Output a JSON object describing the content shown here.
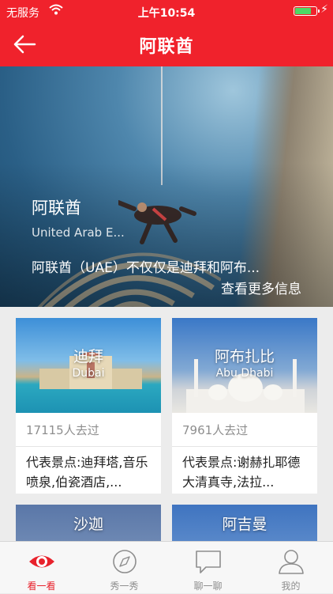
{
  "status_bar": {
    "carrier": "无服务",
    "time": "上午10:54"
  },
  "nav": {
    "title": "阿联酋"
  },
  "hero": {
    "title": "阿联酋",
    "subtitle": "United Arab E...",
    "description": "阿联酋（UAE）不仅仅是迪拜和阿布...",
    "more_link": "查看更多信息"
  },
  "destinations": [
    {
      "name_cn": "迪拜",
      "name_en": "Dubai",
      "visits": "17115人去过",
      "highlights": "代表景点:迪拜塔,音乐喷泉,伯瓷酒店,..."
    },
    {
      "name_cn": "阿布扎比",
      "name_en": "Abu Dhabi",
      "visits": "7961人去过",
      "highlights": "代表景点:谢赫扎耶德大清真寺,法拉..."
    },
    {
      "name_cn": "沙迦",
      "name_en": ""
    },
    {
      "name_cn": "阿吉曼",
      "name_en": ""
    }
  ],
  "tabs": [
    {
      "label": "看一看",
      "icon": "eye-icon",
      "active": true
    },
    {
      "label": "秀一秀",
      "icon": "compass-icon",
      "active": false
    },
    {
      "label": "聊一聊",
      "icon": "chat-bubble-icon",
      "active": false
    },
    {
      "label": "我的",
      "icon": "user-icon",
      "active": false
    }
  ],
  "colors": {
    "brand_red": "#f0222c",
    "tab_active": "#e8222c",
    "tab_inactive": "#8e8e8e"
  }
}
